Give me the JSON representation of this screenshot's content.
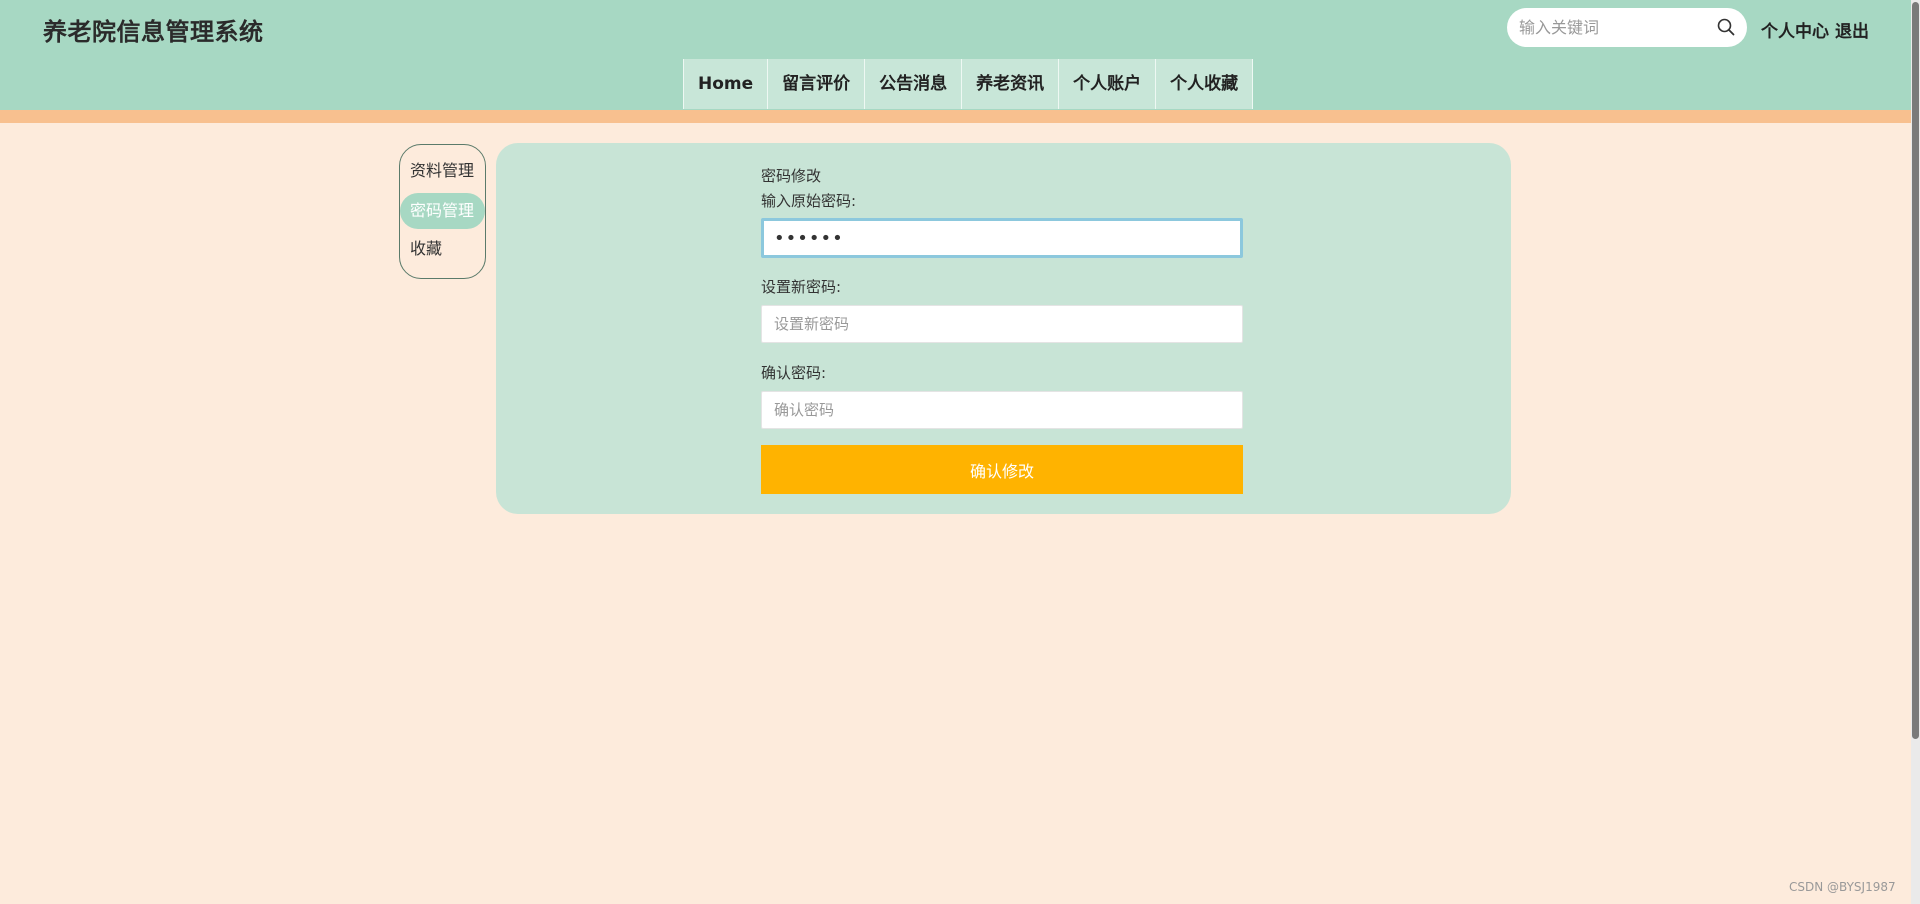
{
  "header": {
    "title": "养老院信息管理系统",
    "search": {
      "placeholder": "输入关键词",
      "value": ""
    },
    "links": {
      "personal_center": "个人中心",
      "logout": "退出"
    }
  },
  "nav": {
    "items": [
      {
        "label": "Home"
      },
      {
        "label": "留言评价"
      },
      {
        "label": "公告消息"
      },
      {
        "label": "养老资讯"
      },
      {
        "label": "个人账户"
      },
      {
        "label": "个人收藏"
      }
    ]
  },
  "sidebar": {
    "items": [
      {
        "label": "资料管理",
        "active": false
      },
      {
        "label": "密码管理",
        "active": true
      },
      {
        "label": "收藏",
        "active": false
      }
    ]
  },
  "form": {
    "heading": "密码修改",
    "old_password": {
      "label": "输入原始密码:",
      "value": "123456",
      "placeholder": ""
    },
    "new_password": {
      "label": "设置新密码:",
      "value": "",
      "placeholder": "设置新密码"
    },
    "confirm_password": {
      "label": "确认密码:",
      "value": "",
      "placeholder": "确认密码"
    },
    "submit_label": "确认修改"
  },
  "watermark": "CSDN @BYSJ1987",
  "colors": {
    "header_bg": "#a7d8c3",
    "accent_orange": "#f8c08f",
    "page_bg": "#fdebdc",
    "panel_bg": "#c8e4d6",
    "button": "#ffb300",
    "nav_item_bg": "#c8e6d8"
  }
}
